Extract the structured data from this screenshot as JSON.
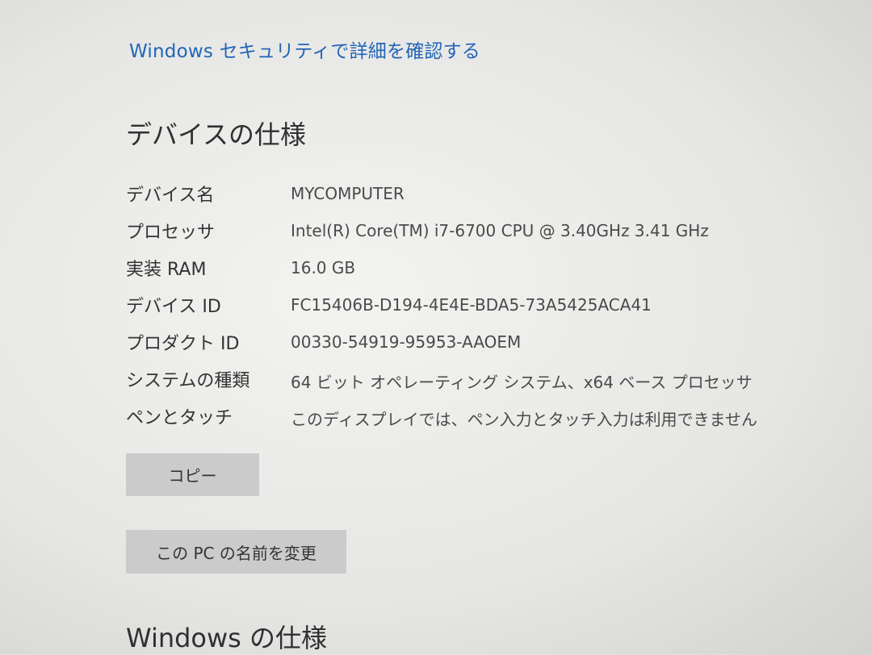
{
  "security_link": "Windows セキュリティで詳細を確認する",
  "device_specs": {
    "title": "デバイスの仕様",
    "rows": [
      {
        "label": "デバイス名",
        "value": "MYCOMPUTER"
      },
      {
        "label": "プロセッサ",
        "value": "Intel(R) Core(TM) i7-6700 CPU @ 3.40GHz   3.41 GHz"
      },
      {
        "label": "実装 RAM",
        "value": "16.0 GB"
      },
      {
        "label": "デバイス ID",
        "value": "FC15406B-D194-4E4E-BDA5-73A5425ACA41"
      },
      {
        "label": "プロダクト ID",
        "value": "00330-54919-95953-AAOEM"
      },
      {
        "label": "システムの種類",
        "value": "64 ビット オペレーティング システム、x64 ベース プロセッサ"
      },
      {
        "label": "ペンとタッチ",
        "value": "このディスプレイでは、ペン入力とタッチ入力は利用できません"
      }
    ],
    "copy_button": "コピー",
    "rename_button": "この PC の名前を変更"
  },
  "windows_specs": {
    "title": "Windows の仕様"
  }
}
